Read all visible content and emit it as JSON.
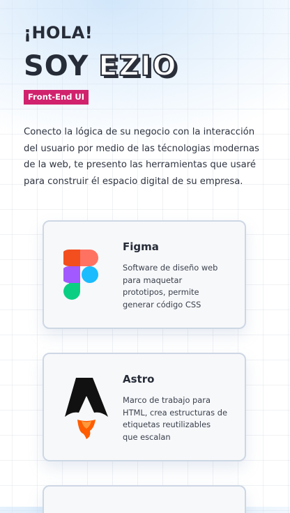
{
  "hero": {
    "greeting": "¡HOLA!",
    "title_prefix": "SOY",
    "title_name": "EZIO",
    "badge": "Front-End UI",
    "intro": "Conecto la lógica de su negocio con la interacción del usuario por medio de las técnologias modernas de la web, te presento las herramientas que usaré para construir él espacio digital de su empresa."
  },
  "tools": [
    {
      "name": "Figma",
      "icon": "figma-logo",
      "description": "Software de diseño web para maquetar prototipos, permite generar código CSS"
    },
    {
      "name": "Astro",
      "icon": "astro-logo",
      "description": "Marco de trabajo para HTML, crea estructuras de etiquetas reutilizables que escalan"
    }
  ],
  "colors": {
    "accent": "#d1226d",
    "text": "#262c38",
    "card_border": "#cdd7e4"
  }
}
